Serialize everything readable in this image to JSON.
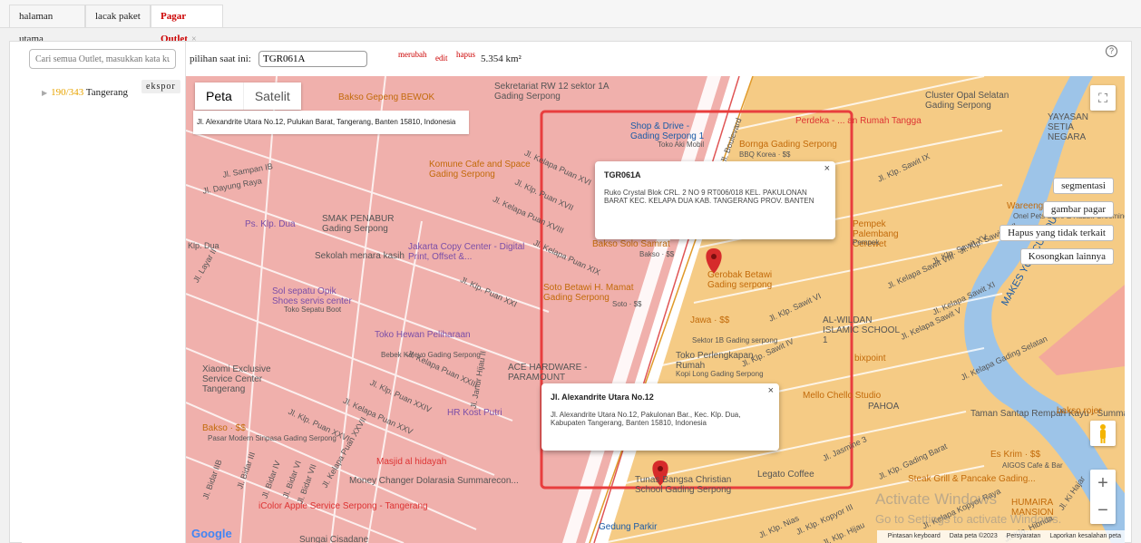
{
  "tabs": [
    {
      "label": "halaman utama"
    },
    {
      "label": "lacak paket"
    },
    {
      "label": "Pagar Outlet",
      "close": "×"
    }
  ],
  "sidebar": {
    "search_placeholder": "Cari semua Outlet, masukkan kata ku",
    "export_label": "ekspor",
    "tree": {
      "count": "190/343",
      "name": "Tangerang"
    }
  },
  "toolbar": {
    "current_label": "pilihan saat ini:",
    "current_value": "TGR061A",
    "change": "merubah",
    "edit": "edit",
    "delete": "hapus",
    "area": "5.354 km²",
    "help": "?"
  },
  "map": {
    "type_map": "Peta",
    "type_satellite": "Satelit",
    "address_box": "Jl. Alexandrite Utara No.12, Pulukan Barat, Tangerang, Banten 15810, Indonesia",
    "popup1": {
      "title": "TGR061A",
      "text": "Ruko Crystal Blok CRL. 2 NO 9 RT006/018 KEL. PAKULONAN BARAT KEC. KELAPA DUA KAB. TANGERANG PROV. BANTEN",
      "close": "×"
    },
    "popup2": {
      "title": "Jl. Alexandrite Utara No.12",
      "text": "Jl. Alexandrite Utara No.12, Pakulonan Bar., Kec. Klp. Dua, Kabupaten Tangerang, Banten 15810, Indonesia",
      "close": "×"
    },
    "buttons": {
      "segment": "segmentasi",
      "draw": "gambar pagar",
      "remove_unrelated": "Hapus yang tidak terkait",
      "clear": "Kosongkan lainnya"
    },
    "zoom_in": "+",
    "zoom_out": "−",
    "footer": {
      "shortcuts": "Pintasan keyboard",
      "data": "Data peta ©2023",
      "terms": "Persyaratan",
      "report": "Laporkan kesalahan peta"
    },
    "google": "Google",
    "watermark1": "Activate Windows",
    "watermark2": "Go to Settings to activate Windows.",
    "pois": [
      {
        "t": "Bakso Gepeng BEWOK"
      },
      {
        "t": "Sekretariat RW 12 sektor 1A Gading Serpong"
      },
      {
        "t": "Shop & Drive - Gading Serpong 1"
      },
      {
        "t": "Toko Aki Mobil"
      },
      {
        "t": "Bornga Gading Serpong"
      },
      {
        "t": "BBQ Korea · $$"
      },
      {
        "t": "Cluster Opal Selatan Gading Serpong"
      },
      {
        "t": "YAYASAN SETIA NEGARA"
      },
      {
        "t": "Komune Cafe and Space Gading Serpong"
      },
      {
        "t": "SMAK PENABUR Gading Serpong"
      },
      {
        "t": "Ps. Klp. Dua"
      },
      {
        "t": "Jakarta Copy Center - Digital Print, Offset &..."
      },
      {
        "t": "Sekolah menara kasih"
      },
      {
        "t": "Sol sepatu Opik Shoes servis center"
      },
      {
        "t": "Toko Sepatu Boot"
      },
      {
        "t": "Bakso Solo Samrat"
      },
      {
        "t": "Bakso · $$"
      },
      {
        "t": "Gerobak Betawi Gading serpong"
      },
      {
        "t": "Soto Betawi H. Mamat Gading Serpong"
      },
      {
        "t": "Soto · $$"
      },
      {
        "t": "Pempek Palembang Cerewet"
      },
      {
        "t": "Pempek"
      },
      {
        "t": "Wareeng Prasmanan"
      },
      {
        "t": "Onel Pets Store & Rabbit Grooming"
      },
      {
        "t": "Toko Hewan Peliharaan"
      },
      {
        "t": "Bebek Kaleyo Gading Serpong"
      },
      {
        "t": "Jawa · $$"
      },
      {
        "t": "Sektor 1B Gading serpong"
      },
      {
        "t": "AL-WILDAN ISLAMIC SCHOOL 1"
      },
      {
        "t": "Xiaomi Exclusive Service Center Tangerang"
      },
      {
        "t": "ACE HARDWARE - PARAMOUNT"
      },
      {
        "t": "Toko Perlengkapan Rumah"
      },
      {
        "t": "Kopi Long Gading Serpong"
      },
      {
        "t": "bixpoint"
      },
      {
        "t": "Mello Chello Studio"
      },
      {
        "t": "PAHOA"
      },
      {
        "t": "Taman Santap Rempah Kayu - Summarecon"
      },
      {
        "t": "bakso rojer"
      },
      {
        "t": "Bakso · $$"
      },
      {
        "t": "Pasar Modern Sinpasa Gading Serpong"
      },
      {
        "t": "HR Kost Putri"
      },
      {
        "t": "Masjid al hidayah"
      },
      {
        "t": "Money Changer Dolarasia Summarecon..."
      },
      {
        "t": "Tunas Bangsa Christian School Gading Serpong"
      },
      {
        "t": "Legato Coffee"
      },
      {
        "t": "Es Krim · $$"
      },
      {
        "t": "AIGOS Cafe & Bar"
      },
      {
        "t": "Steak Grill & Pancake Gading..."
      },
      {
        "t": "HUMAIRA MANSION"
      },
      {
        "t": "iColor Apple Service Serpong - Tangerang"
      },
      {
        "t": "Gedung Parkir"
      },
      {
        "t": "Sungai Cisadane"
      },
      {
        "t": "MAKES YOU CURIOUS"
      },
      {
        "t": "Perdeka - ... an Rumah Tangga"
      }
    ],
    "streets": [
      {
        "t": "Jl. Sampan IB"
      },
      {
        "t": "Jl. Dayung Raya"
      },
      {
        "t": "Klp. Dua"
      },
      {
        "t": "Jl. Layar II"
      },
      {
        "t": "Jl. Kelapa Puan XVI"
      },
      {
        "t": "Jl. Klp. Puan XVII"
      },
      {
        "t": "Jl. Kelapa Puan XVIII"
      },
      {
        "t": "Jl. Kelapa Puan XIX"
      },
      {
        "t": "Jl. Klp. Puan XXI"
      },
      {
        "t": "Jl. Kelapa Puan XXIII"
      },
      {
        "t": "Jl. Klp. Puan XXIV"
      },
      {
        "t": "Jl. Kelapa Puan XXV"
      },
      {
        "t": "Jl. Klp. Puan XXVI"
      },
      {
        "t": "Jl. Kelapa Puan XXVII"
      },
      {
        "t": "Jl. Janur Hijau II"
      },
      {
        "t": "Jl. Bidar IIB"
      },
      {
        "t": "Jl. Bidar III"
      },
      {
        "t": "Jl. Bidar IV"
      },
      {
        "t": "Jl. Bidar VI"
      },
      {
        "t": "Jl. Bidar VII"
      },
      {
        "t": "Jl. Klp. Sawit IX"
      },
      {
        "t": "Jl. Kelapa Sawit VIII"
      },
      {
        "t": "Jl. Klp. Sawit VI"
      },
      {
        "t": "Jl. Kelapa Sawit V"
      },
      {
        "t": "Jl. Klp. Sawit IV"
      },
      {
        "t": "Jl. Klp. Sawit XV"
      },
      {
        "t": "Jl. Kelapa Sawit XI"
      },
      {
        "t": "Jl. Klp. Sawit XVI"
      },
      {
        "t": "Jl. Kelapa Gading Selatan"
      },
      {
        "t": "Jl. Boulevard"
      },
      {
        "t": "Jl. Klp. Gading Barat"
      },
      {
        "t": "Jl. Kelapa Kopyor Raya"
      },
      {
        "t": "Jl. Klp. Kopyor III"
      },
      {
        "t": "Jl. Klp. Nias"
      },
      {
        "t": "Jl. Klp. Hibrida"
      },
      {
        "t": "Jl. Klp. Hijau"
      },
      {
        "t": "Jl. Jasmine 3"
      },
      {
        "t": "Jl. Ki Hajar"
      }
    ]
  }
}
